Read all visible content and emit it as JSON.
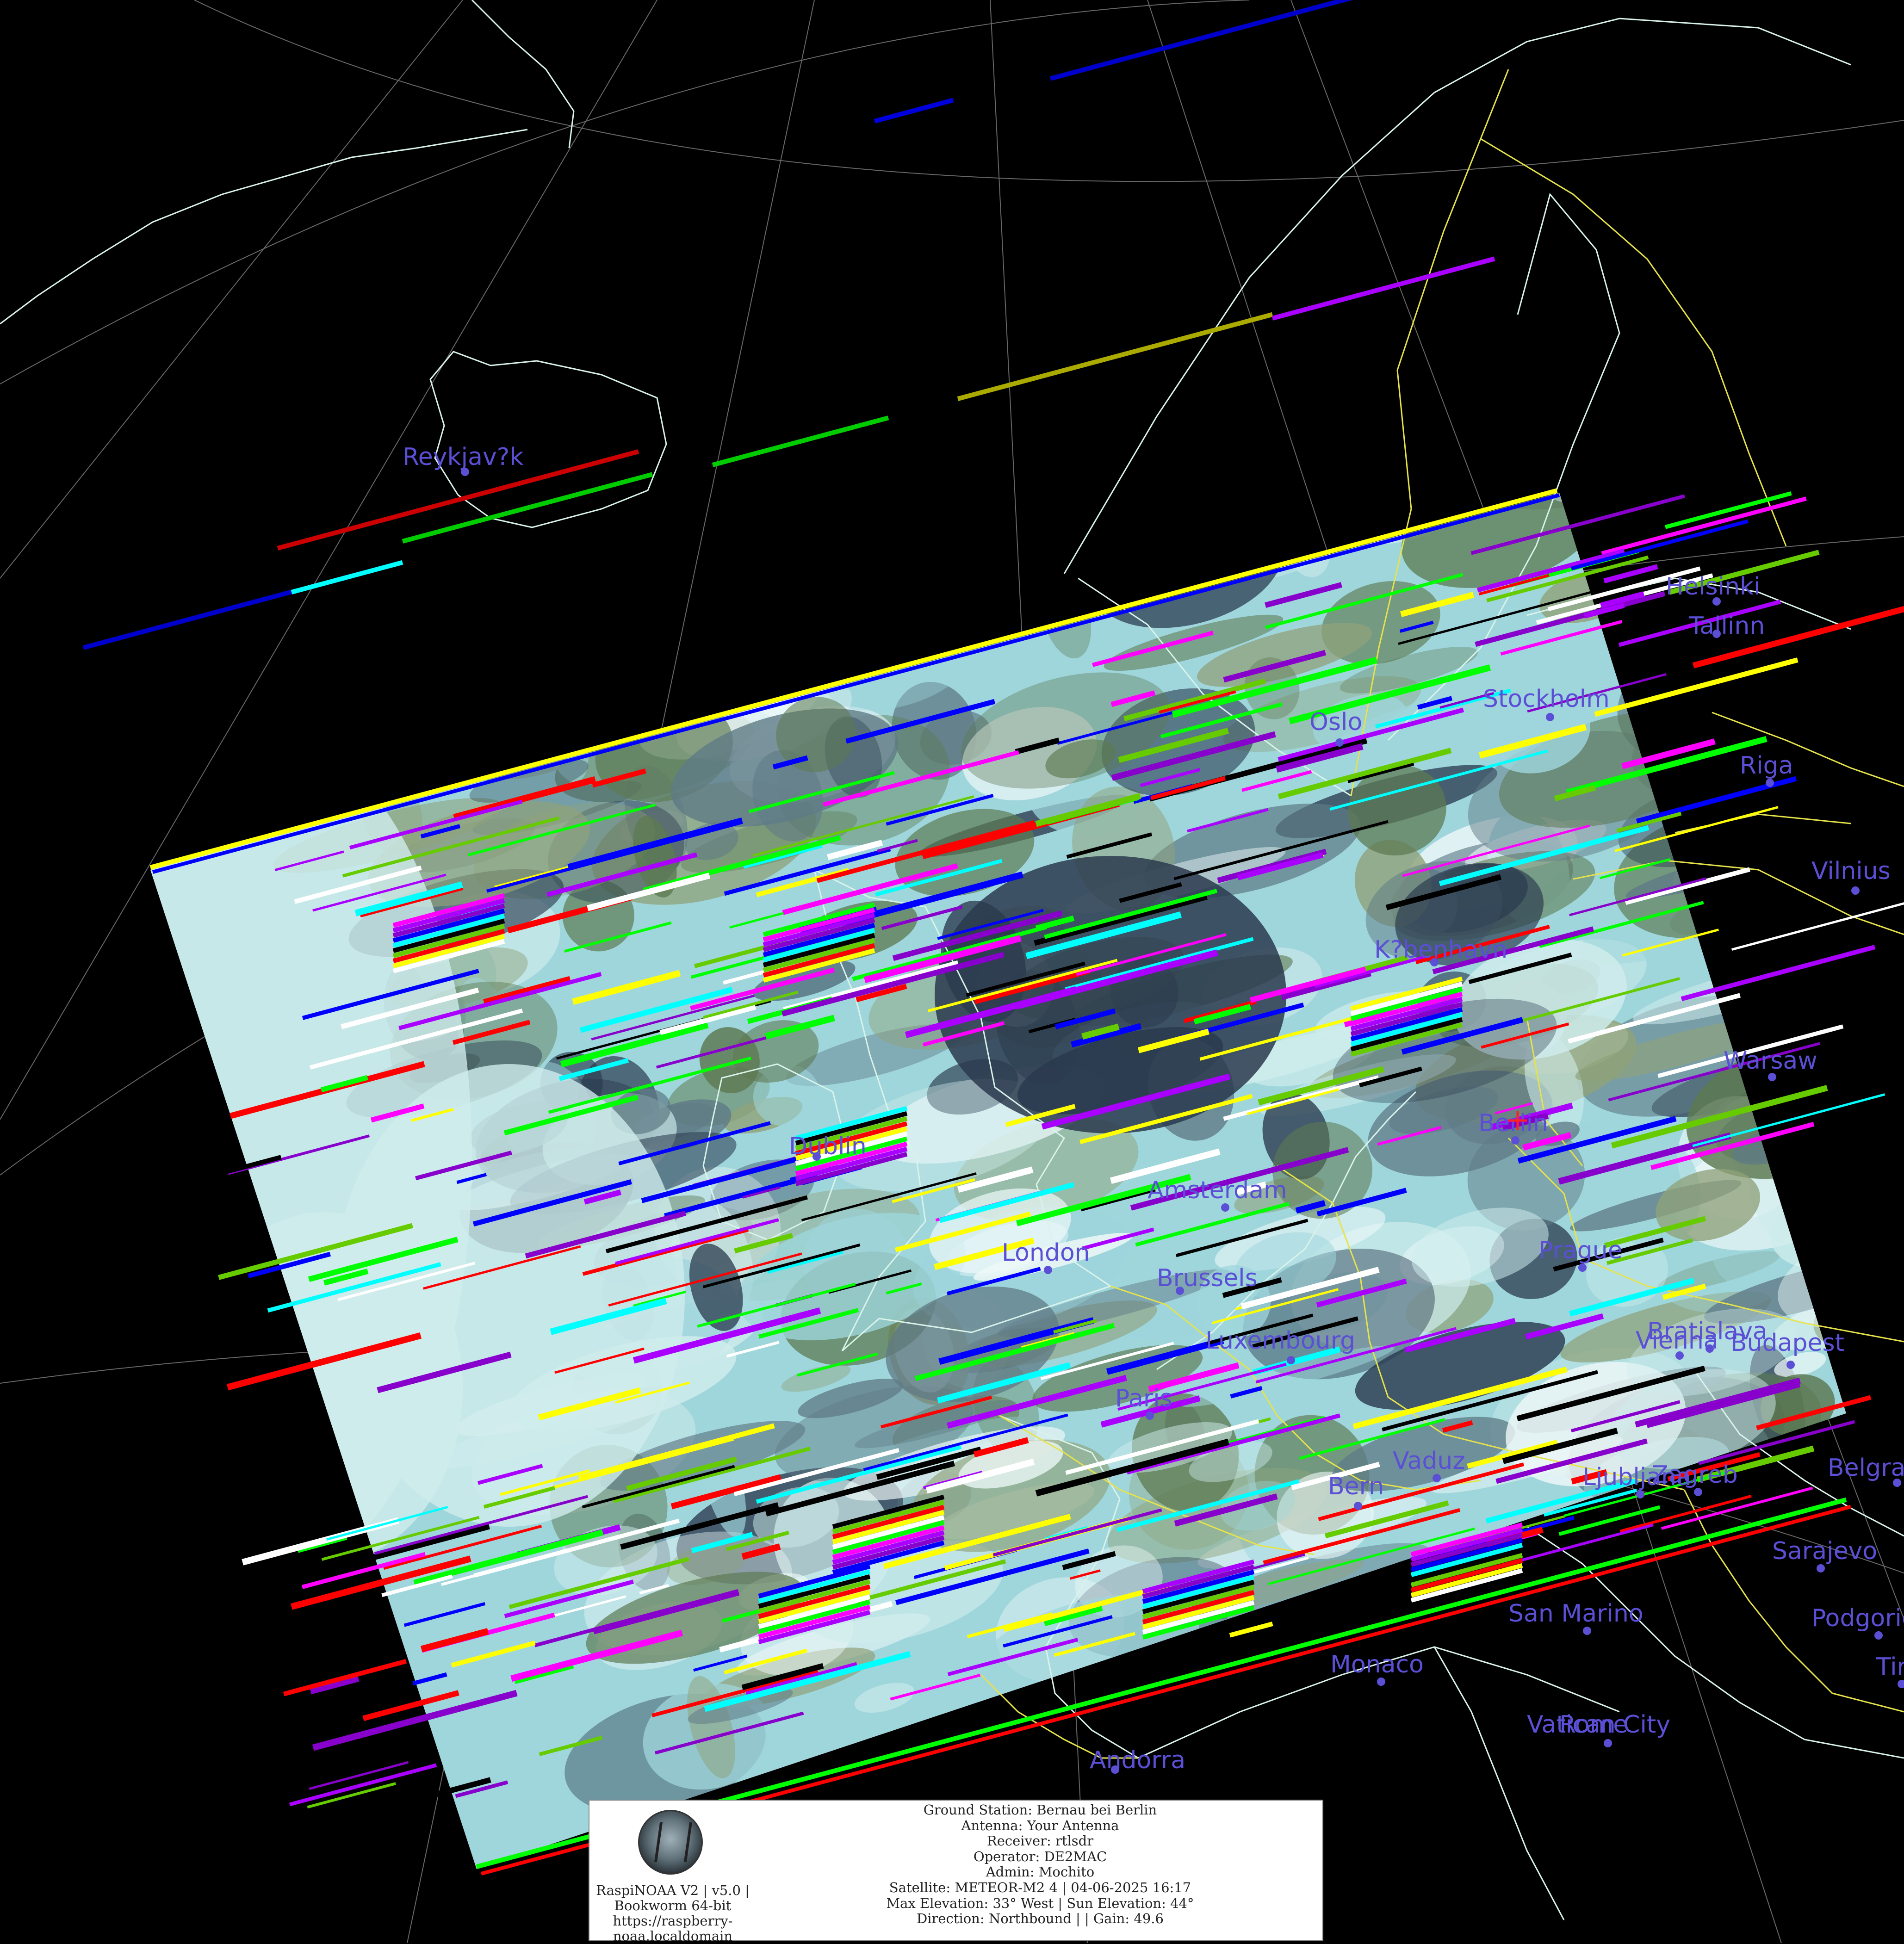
{
  "image": {
    "background": "#000000",
    "swath_colors": [
      "#cfecec",
      "#9fd6dc",
      "#5f7a86",
      "#2a3a4e",
      "#5d7a52",
      "#8fa27a",
      "#eef8f8"
    ],
    "noise_colors": [
      "#00ff00",
      "#0000ff",
      "#ff0000",
      "#ff00ff",
      "#00ffff",
      "#ffff00",
      "#aa00ff",
      "#000000",
      "#ffffff",
      "#8800cc",
      "#66cc00"
    ],
    "coast_color": "#d9f3ea",
    "border_color": "#e6e34a",
    "graticule_color": "#8a8a8a",
    "city_color": "#5b4fd6",
    "marker_color": "#ff2222"
  },
  "cities": [
    {
      "name": "Reykjav?k"
    },
    {
      "name": "Helsinki"
    },
    {
      "name": "Tallinn"
    },
    {
      "name": "Oslo"
    },
    {
      "name": "Stockholm"
    },
    {
      "name": "Riga"
    },
    {
      "name": "Vilnius"
    },
    {
      "name": "K?benhavn"
    },
    {
      "name": "Warsaw"
    },
    {
      "name": "Berlin"
    },
    {
      "name": "Dublin"
    },
    {
      "name": "Amsterdam"
    },
    {
      "name": "London"
    },
    {
      "name": "Brussels"
    },
    {
      "name": "Prague"
    },
    {
      "name": "Luxembourg"
    },
    {
      "name": "Bratislava"
    },
    {
      "name": "Vienna"
    },
    {
      "name": "Budapest"
    },
    {
      "name": "Paris"
    },
    {
      "name": "Vaduz"
    },
    {
      "name": "Bern"
    },
    {
      "name": "Ljubljana"
    },
    {
      "name": "Zagreb"
    },
    {
      "name": "Belgrade"
    },
    {
      "name": "Sarajevo"
    },
    {
      "name": "San Marino"
    },
    {
      "name": "Podgorica"
    },
    {
      "name": "Tirana"
    },
    {
      "name": "Monaco"
    },
    {
      "name": "Vatican City"
    },
    {
      "name": "Rome"
    },
    {
      "name": "Andorra"
    }
  ],
  "panel": {
    "left_lines": [
      "RaspiNOAA V2 | v5.0 |",
      "Bookworm 64-bit",
      "https://raspberry-",
      "noaa.localdomain"
    ],
    "right_lines": [
      "Ground Station: Bernau bei Berlin",
      "Antenna: Your Antenna",
      "Receiver: rtlsdr",
      "Operator: DE2MAC",
      "Admin: Mochito",
      "Satellite: METEOR-M2 4 | 04-06-2025 16:17",
      "Max Elevation: 33° West | Sun Elevation: 44°",
      "Direction: Northbound | | Gain: 49.6"
    ]
  }
}
